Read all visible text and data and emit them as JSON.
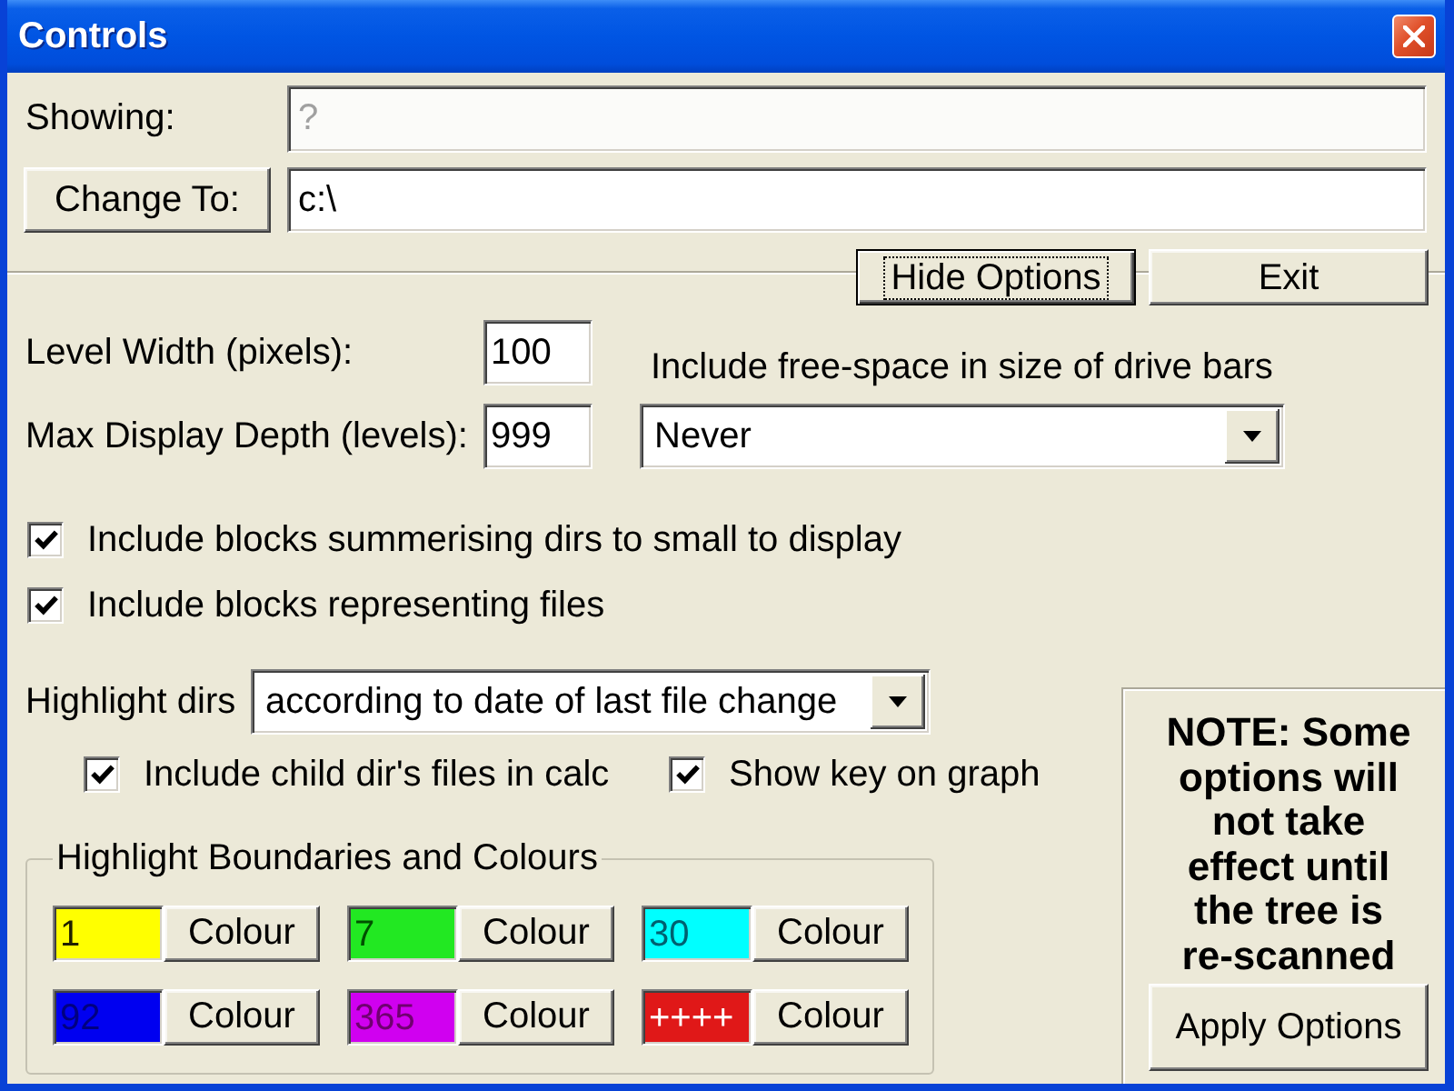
{
  "window": {
    "title": "Controls"
  },
  "showing": {
    "label": "Showing:",
    "value": "?",
    "disabled": true
  },
  "change_to": {
    "button": "Change To:",
    "value": "c:\\"
  },
  "actions": [
    {
      "label": "Hide Options",
      "focused": true
    },
    {
      "label": "Exit",
      "focused": false
    }
  ],
  "level_width": {
    "label": "Level Width (pixels):",
    "value": "100"
  },
  "max_depth": {
    "label": "Max Display Depth (levels):",
    "value": "999"
  },
  "free_space": {
    "label": "Include free-space in size of drive bars",
    "value": "Never"
  },
  "options": [
    {
      "label": "Include blocks summerising dirs to small to display",
      "checked": true
    },
    {
      "label": "Include blocks representing files",
      "checked": true
    }
  ],
  "highlight": {
    "label": "Highlight dirs",
    "value": "according to date of last file change",
    "options": [
      {
        "label": "Include child dir's files in calc",
        "checked": true
      },
      {
        "label": "Show key on graph",
        "checked": true
      }
    ]
  },
  "boundaries": {
    "title": "Highlight Boundaries and Colours",
    "items": [
      {
        "label": {
          "text": "1",
          "color": "#202000"
        },
        "color": "#ffff00",
        "button": "Colour"
      },
      {
        "label": {
          "text": "7",
          "color": "#005000"
        },
        "color": "#22e822",
        "button": "Colour"
      },
      {
        "label": {
          "text": "30",
          "color": "#006070"
        },
        "color": "#00ffff",
        "button": "Colour"
      },
      {
        "label": {
          "text": "92",
          "color": "#000080"
        },
        "color": "#0000f0",
        "button": "Colour"
      },
      {
        "label": {
          "text": "365",
          "color": "#700070"
        },
        "color": "#d000f0",
        "button": "Colour"
      },
      {
        "label": {
          "text": "++++",
          "color": "#ffffff"
        },
        "color": "#e01818",
        "button": "Colour"
      }
    ]
  },
  "note": {
    "text": "NOTE: Some options will not take effect until the tree is re-scanned",
    "button": "Apply Options"
  }
}
